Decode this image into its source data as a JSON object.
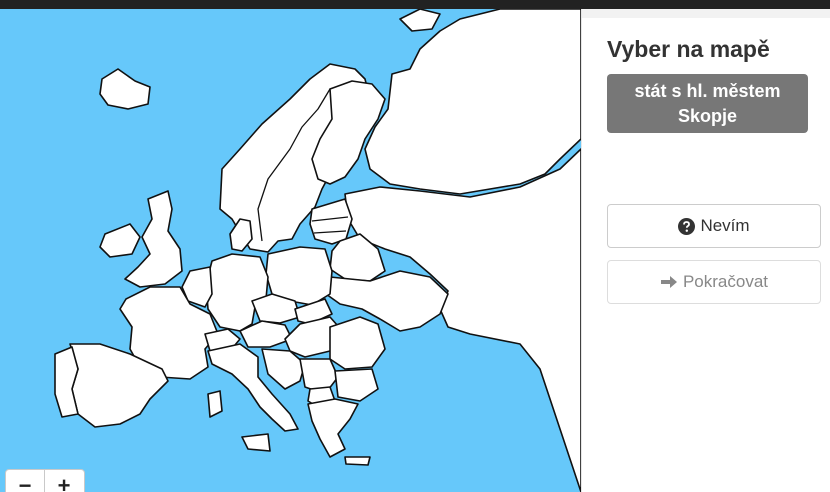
{
  "map": {
    "zoom_out_label": "−",
    "zoom_in_label": "+",
    "colors": {
      "sea": "#66c8fa",
      "land": "#ffffff",
      "borders": "#111111"
    }
  },
  "panel": {
    "title": "Vyber na mapě",
    "target_line1": "stát s hl. městem",
    "target_line2": "Skopje",
    "dont_know_label": "Nevím",
    "continue_label": "Pokračovat",
    "icons": {
      "dont_know": "question-circle-icon",
      "continue": "arrow-right-icon"
    }
  }
}
